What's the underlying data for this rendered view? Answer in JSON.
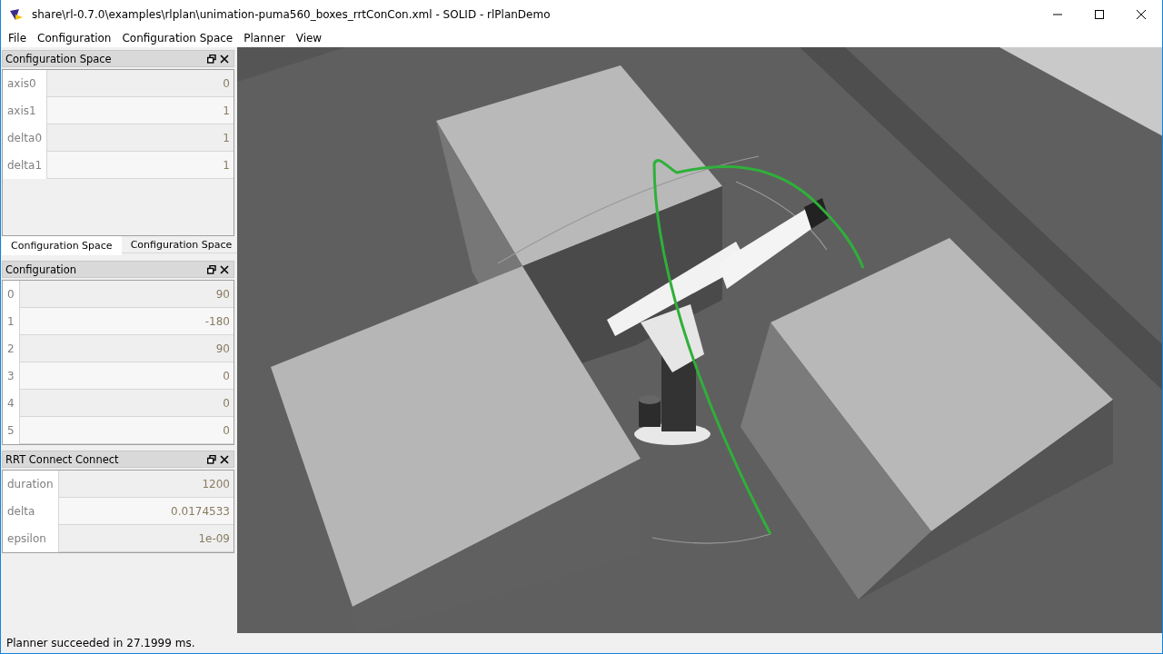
{
  "window": {
    "title": "share\\rl-0.7.0\\examples\\rlplan\\unimation-puma560_boxes_rrtConCon.xml - SOLID - rlPlanDemo"
  },
  "menu": [
    "File",
    "Configuration",
    "Configuration Space",
    "Planner",
    "View"
  ],
  "docks": [
    {
      "title": "Configuration Space",
      "rows": [
        {
          "label": "axis0",
          "value": "0"
        },
        {
          "label": "axis1",
          "value": "1"
        },
        {
          "label": "delta0",
          "value": "1"
        },
        {
          "label": "delta1",
          "value": "1"
        }
      ],
      "tabs": [
        {
          "label": "Configuration Space",
          "selected": true
        },
        {
          "label": "Configuration Space",
          "selected": false
        }
      ]
    },
    {
      "title": "Configuration",
      "rows": [
        {
          "label": "0",
          "value": "90"
        },
        {
          "label": "1",
          "value": "-180"
        },
        {
          "label": "2",
          "value": "90"
        },
        {
          "label": "3",
          "value": "0"
        },
        {
          "label": "4",
          "value": "0"
        },
        {
          "label": "5",
          "value": "0"
        }
      ]
    },
    {
      "title": "RRT Connect Connect",
      "rows": [
        {
          "label": "duration",
          "value": "1200"
        },
        {
          "label": "delta",
          "value": "0.0174533"
        },
        {
          "label": "epsilon",
          "value": "1e-09"
        }
      ]
    }
  ],
  "status_bar": "Planner succeeded in 27.1999 ms."
}
